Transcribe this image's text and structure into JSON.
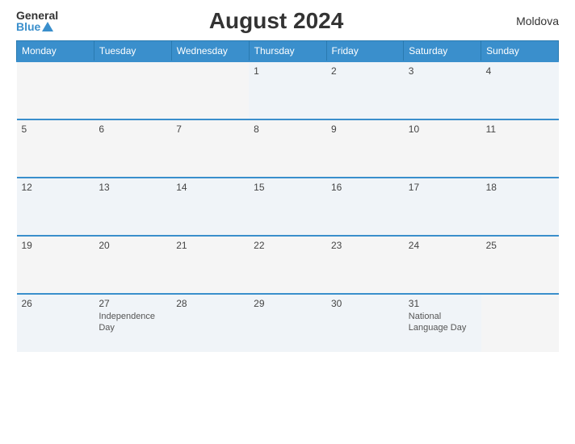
{
  "header": {
    "logo_general": "General",
    "logo_blue": "Blue",
    "title": "August 2024",
    "country": "Moldova"
  },
  "weekdays": [
    "Monday",
    "Tuesday",
    "Wednesday",
    "Thursday",
    "Friday",
    "Saturday",
    "Sunday"
  ],
  "weeks": [
    [
      {
        "day": "",
        "event": ""
      },
      {
        "day": "",
        "event": ""
      },
      {
        "day": "",
        "event": ""
      },
      {
        "day": "1",
        "event": ""
      },
      {
        "day": "2",
        "event": ""
      },
      {
        "day": "3",
        "event": ""
      },
      {
        "day": "4",
        "event": ""
      }
    ],
    [
      {
        "day": "5",
        "event": ""
      },
      {
        "day": "6",
        "event": ""
      },
      {
        "day": "7",
        "event": ""
      },
      {
        "day": "8",
        "event": ""
      },
      {
        "day": "9",
        "event": ""
      },
      {
        "day": "10",
        "event": ""
      },
      {
        "day": "11",
        "event": ""
      }
    ],
    [
      {
        "day": "12",
        "event": ""
      },
      {
        "day": "13",
        "event": ""
      },
      {
        "day": "14",
        "event": ""
      },
      {
        "day": "15",
        "event": ""
      },
      {
        "day": "16",
        "event": ""
      },
      {
        "day": "17",
        "event": ""
      },
      {
        "day": "18",
        "event": ""
      }
    ],
    [
      {
        "day": "19",
        "event": ""
      },
      {
        "day": "20",
        "event": ""
      },
      {
        "day": "21",
        "event": ""
      },
      {
        "day": "22",
        "event": ""
      },
      {
        "day": "23",
        "event": ""
      },
      {
        "day": "24",
        "event": ""
      },
      {
        "day": "25",
        "event": ""
      }
    ],
    [
      {
        "day": "26",
        "event": ""
      },
      {
        "day": "27",
        "event": "Independence Day"
      },
      {
        "day": "28",
        "event": ""
      },
      {
        "day": "29",
        "event": ""
      },
      {
        "day": "30",
        "event": ""
      },
      {
        "day": "31",
        "event": "National Language Day"
      },
      {
        "day": "",
        "event": ""
      }
    ]
  ]
}
